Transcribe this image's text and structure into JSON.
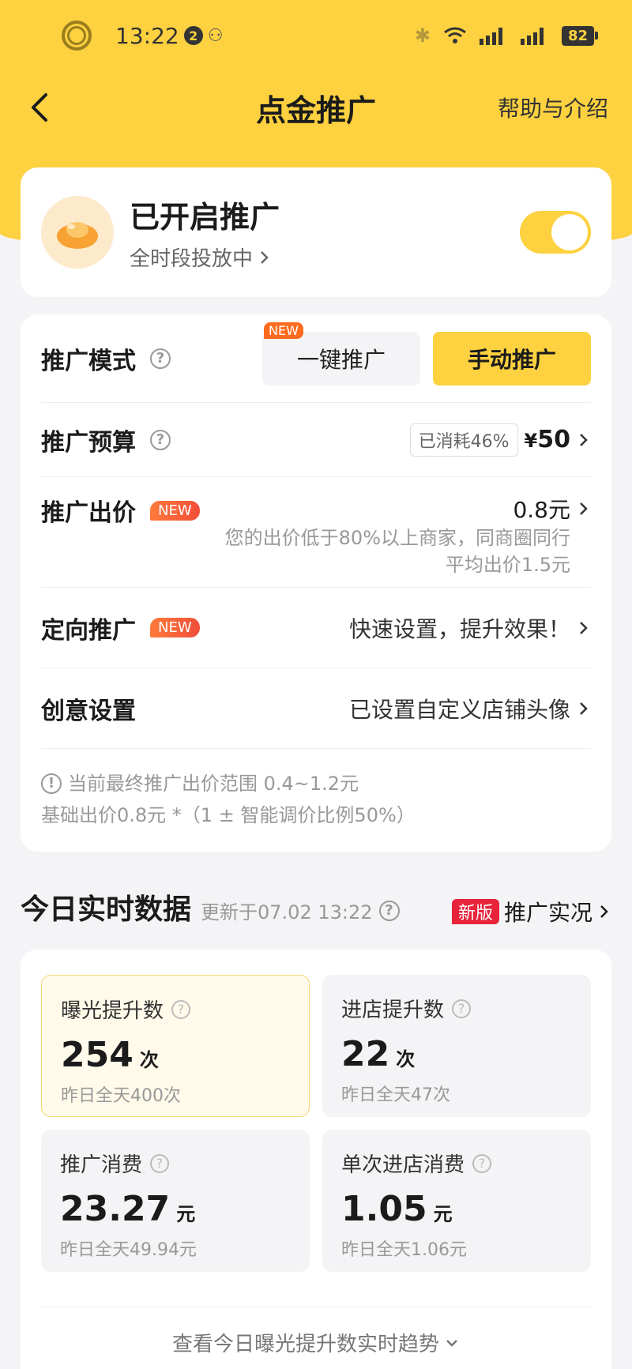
{
  "status_bar": {
    "time": "13:22",
    "notification_count": "2",
    "battery": "82"
  },
  "nav": {
    "title": "点金推广",
    "help": "帮助与介绍"
  },
  "promo_status": {
    "title": "已开启推广",
    "subtitle": "全时段投放中",
    "enabled": true
  },
  "settings": {
    "mode": {
      "label": "推广模式",
      "options": [
        "一键推广",
        "手动推广"
      ],
      "new_tag": "NEW",
      "selected": "手动推广"
    },
    "budget": {
      "label": "推广预算",
      "consumed": "已消耗46%",
      "currency": "¥",
      "value": "50"
    },
    "bid": {
      "label": "推广出价",
      "new_tag": "NEW",
      "value": "0.8元",
      "hint_line1": "您的出价低于80%以上商家，同商圈同行",
      "hint_line2": "平均出价1.5元"
    },
    "targeting": {
      "label": "定向推广",
      "new_tag": "NEW",
      "value": "快速设置，提升效果！"
    },
    "creative": {
      "label": "创意设置",
      "value": "已设置自定义店铺头像"
    },
    "note_line1": "当前最终推广出价范围 0.4~1.2元",
    "note_line2": "基础出价0.8元 *（1 ± 智能调价比例50%）"
  },
  "realtime": {
    "title": "今日实时数据",
    "updated": "更新于07.02 13:22",
    "new_tag": "新版",
    "link": "推广实况",
    "stats": [
      {
        "label": "曝光提升数",
        "value": "254",
        "unit": "次",
        "prev": "昨日全天400次"
      },
      {
        "label": "进店提升数",
        "value": "22",
        "unit": "次",
        "prev": "昨日全天47次"
      },
      {
        "label": "推广消费",
        "value": "23.27",
        "unit": "元",
        "prev": "昨日全天49.94元"
      },
      {
        "label": "单次进店消费",
        "value": "1.05",
        "unit": "元",
        "prev": "昨日全天1.06元"
      }
    ],
    "trend_link": "查看今日曝光提升数实时趋势"
  },
  "colors": {
    "brand_yellow": "#fdd13f",
    "new_orange": "#f04e3a",
    "newver_red": "#e8233a"
  }
}
